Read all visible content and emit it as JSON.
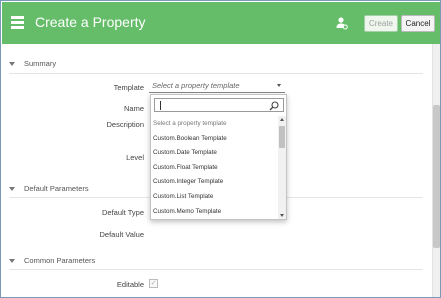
{
  "header": {
    "title": "Create a Property",
    "create_label": "Create",
    "cancel_label": "Cancel",
    "accent_color": "#65bd6a"
  },
  "sections": {
    "summary": "Summary",
    "default_parameters": "Default Parameters",
    "common_parameters": "Common Parameters"
  },
  "fields": {
    "template": "Template",
    "name": "Name",
    "description": "Description",
    "level": "Level",
    "default_type": "Default Type",
    "default_value": "Default Value",
    "editable": "Editable"
  },
  "template_select": {
    "placeholder": "Select a property template",
    "open": true
  },
  "dropdown": {
    "search_value": "",
    "items": [
      "Select a property template",
      "Custom.Boolean Template",
      "Custom.Date Template",
      "Custom.Float Template",
      "Custom.Integer Template",
      "Custom.List Template",
      "Custom.Memo Template"
    ]
  },
  "editable_checked": true
}
